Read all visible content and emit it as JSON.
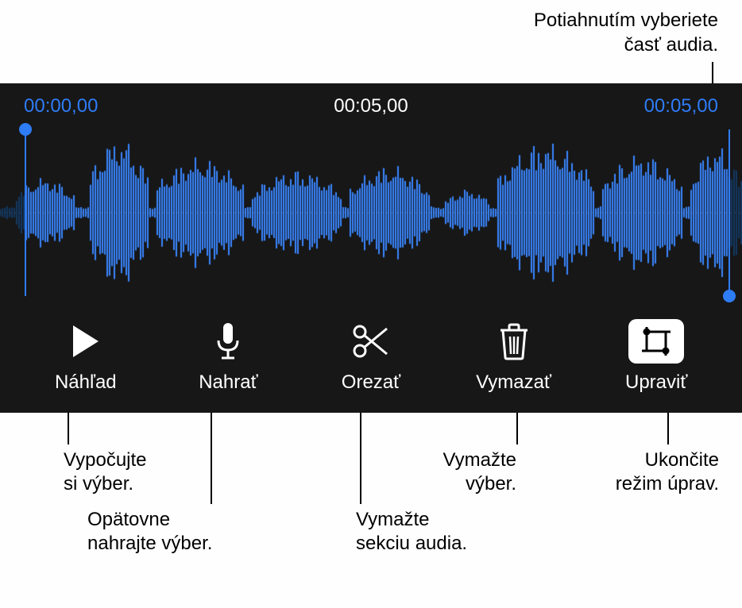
{
  "top_callout": {
    "line1": "Potiahnutím vyberiete",
    "line2": "časť audia."
  },
  "timecodes": {
    "start": "00:00,00",
    "playhead": "00:05,00",
    "end": "00:05,00"
  },
  "toolbar": {
    "preview": "Náhľad",
    "record": "Nahrať",
    "trim": "Orezať",
    "delete": "Vymazať",
    "edit": "Upraviť"
  },
  "callouts": {
    "preview": {
      "line1": "Vypočujte",
      "line2": "si výber."
    },
    "record": {
      "line1": "Opätovne",
      "line2": "nahrajte výber."
    },
    "trim": {
      "line1": "Vymažte",
      "line2": "sekciu audia."
    },
    "delete": {
      "line1": "Vymažte",
      "line2": "výber."
    },
    "edit": {
      "line1": "Ukončite",
      "line2": "režim úprav."
    }
  },
  "colors": {
    "accent_blue": "#2e7cf6",
    "panel_bg": "#171717",
    "wave_blue": "#3a87ff",
    "wave_dim": "#133863"
  }
}
